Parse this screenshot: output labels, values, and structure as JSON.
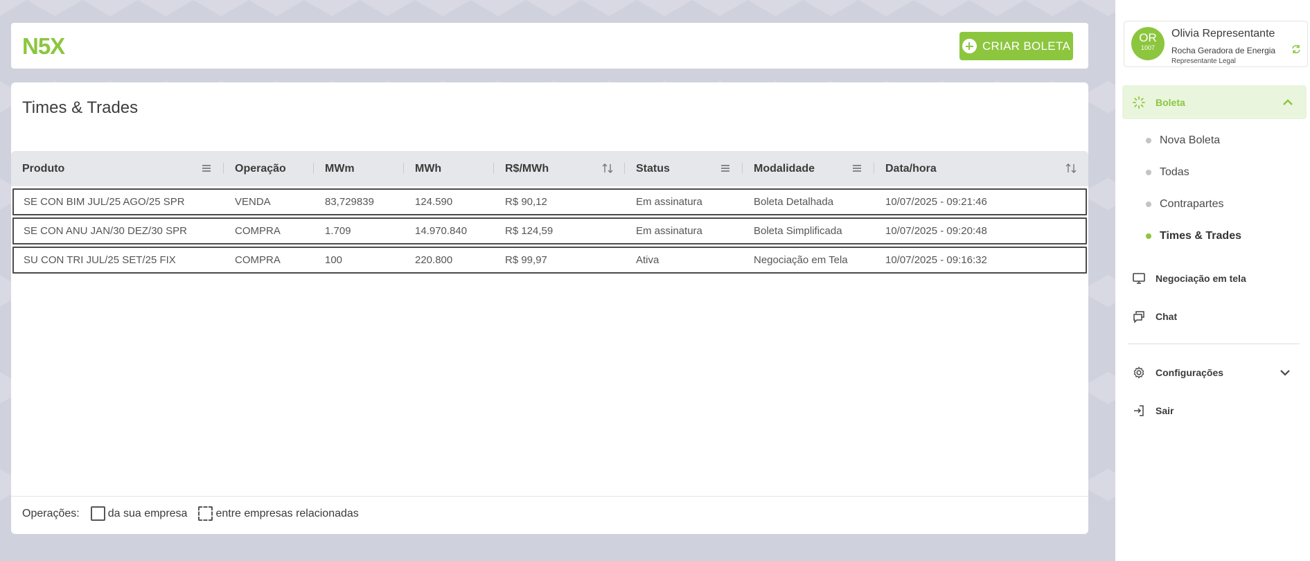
{
  "app": {
    "logo_text": "N5X",
    "create_button_label": "CRIAR BOLETA",
    "brand_color": "#8cc63f"
  },
  "page": {
    "title": "Times & Trades"
  },
  "table": {
    "columns": [
      {
        "label": "Produto",
        "icon": "menu-icon"
      },
      {
        "label": "Operação",
        "icon": ""
      },
      {
        "label": "MWm",
        "icon": ""
      },
      {
        "label": "MWh",
        "icon": ""
      },
      {
        "label": "R$/MWh",
        "icon": "sort-icon"
      },
      {
        "label": "Status",
        "icon": "menu-icon"
      },
      {
        "label": "Modalidade",
        "icon": "menu-icon"
      },
      {
        "label": "Data/hora",
        "icon": "sort-icon"
      }
    ],
    "rows": [
      [
        "SE CON BIM JUL/25 AGO/25 SPR",
        "VENDA",
        "83,729839",
        "124.590",
        "R$ 90,12",
        "Em assinatura",
        "Boleta Detalhada",
        "10/07/2025 - 09:21:46"
      ],
      [
        "SE CON ANU JAN/30 DEZ/30 SPR",
        "COMPRA",
        "1.709",
        "14.970.840",
        "R$ 124,59",
        "Em assinatura",
        "Boleta Simplificada",
        "10/07/2025 - 09:20:48"
      ],
      [
        "SU CON TRI JUL/25 SET/25 FIX",
        "COMPRA",
        "100",
        "220.800",
        "R$ 99,97",
        "Ativa",
        "Negociação em Tela",
        "10/07/2025 - 09:16:32"
      ]
    ]
  },
  "legend": {
    "label": "Operações:",
    "own": "da sua empresa",
    "related": "entre empresas relacionadas"
  },
  "user": {
    "initials": "OR",
    "code": "1007",
    "name": "Olivia Representante",
    "company": "Rocha Geradora de Energia",
    "role": "Representante Legal"
  },
  "sidebar": {
    "boleta_label": "Boleta",
    "boleta_items": [
      "Nova Boleta",
      "Todas",
      "Contrapartes",
      "Times & Trades"
    ],
    "negociacao_label": "Negociação em tela",
    "chat_label": "Chat",
    "config_label": "Configurações",
    "exit_label": "Sair"
  }
}
